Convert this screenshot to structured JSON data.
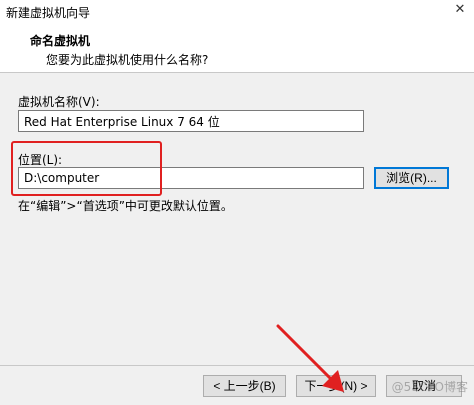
{
  "window": {
    "title": "新建虚拟机向导"
  },
  "header": {
    "heading": "命名虚拟机",
    "subtitle": "您要为此虚拟机使用什么名称?"
  },
  "form": {
    "vm_name_label": "虚拟机名称(V):",
    "vm_name_value": "Red Hat Enterprise Linux 7 64 位",
    "location_label": "位置(L):",
    "location_value": "D:\\computer",
    "browse_label": "浏览(R)...",
    "hint": "在“编辑”>“首选项”中可更改默认位置。"
  },
  "footer": {
    "back_label": "< 上一步(B)",
    "next_label": "下一步(N) >",
    "cancel_label": "取消"
  },
  "watermark": "@51CTO博客",
  "colors": {
    "annotation": "#e02020",
    "focus": "#0078d7"
  }
}
